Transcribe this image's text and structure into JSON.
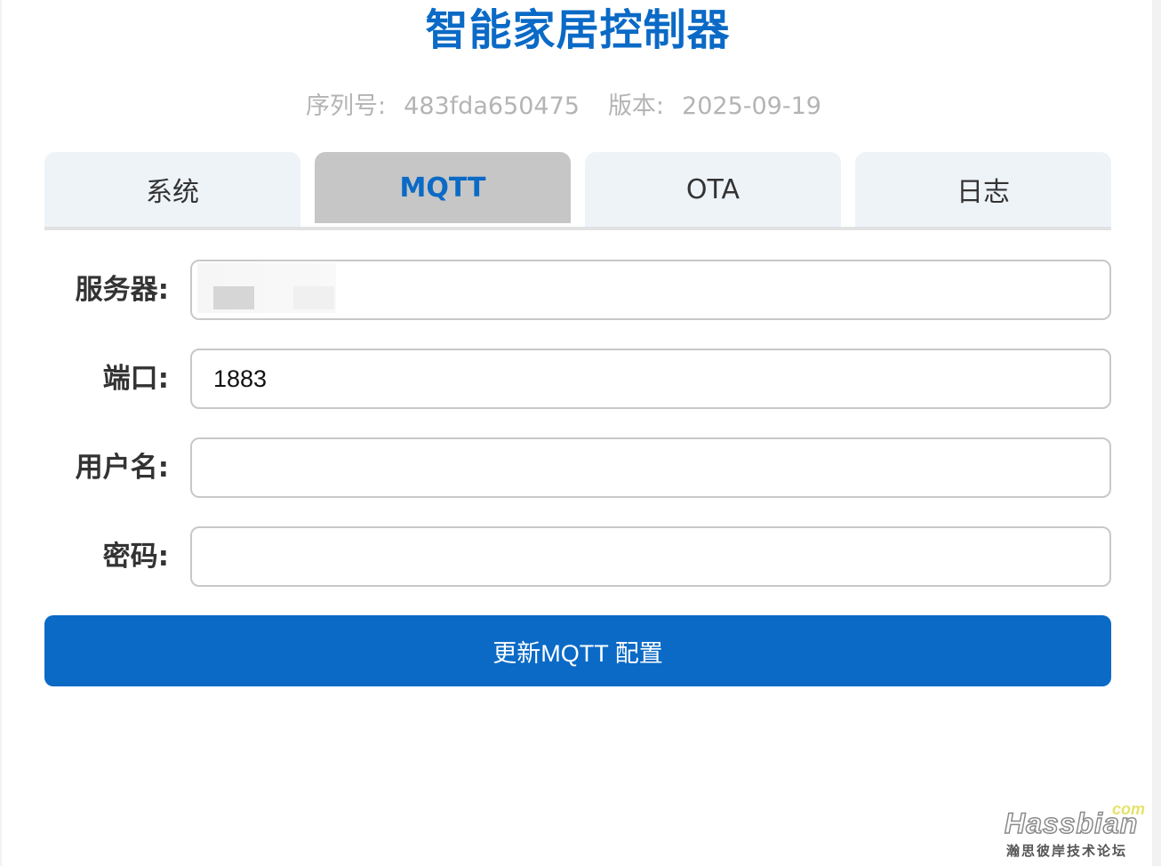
{
  "header": {
    "title": "智能家居控制器",
    "serial_label": "序列号:",
    "serial_value": "483fda650475",
    "version_label": "版本:",
    "version_value": "2025-09-19"
  },
  "tabs": [
    {
      "label": "系统",
      "active": false
    },
    {
      "label": "MQTT",
      "active": true
    },
    {
      "label": "OTA",
      "active": false
    },
    {
      "label": "日志",
      "active": false
    }
  ],
  "form": {
    "server": {
      "label": "服务器:",
      "value": ""
    },
    "port": {
      "label": "端口:",
      "value": "1883"
    },
    "username": {
      "label": "用户名:",
      "value": ""
    },
    "password": {
      "label": "密码:",
      "value": ""
    },
    "submit_label": "更新MQTT 配置"
  },
  "watermark": {
    "logo": "Hassbian",
    "suffix": "com",
    "subtitle": "瀚思彼岸技术论坛"
  },
  "colors": {
    "accent": "#0a6ac6",
    "tab_inactive": "#eef3f8",
    "tab_active": "#c6c6c6",
    "meta_text": "#b4b4b4"
  }
}
